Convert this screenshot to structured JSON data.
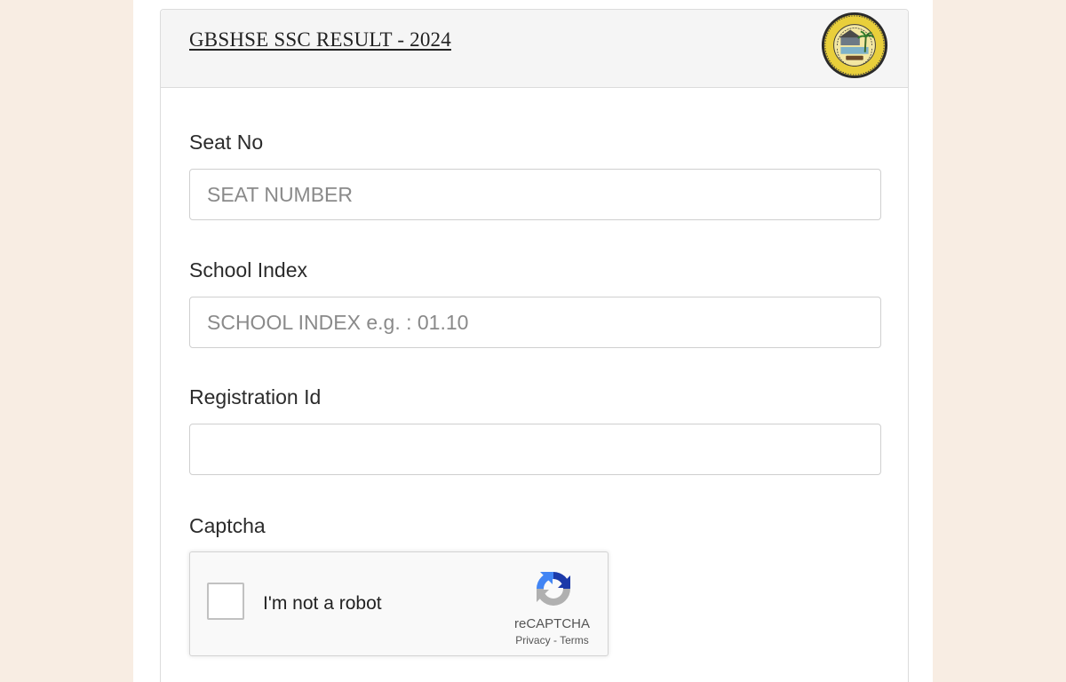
{
  "header": {
    "title": "GBSHSE SSC RESULT - 2024",
    "seal_icon": "board-seal-icon"
  },
  "form": {
    "seat_no": {
      "label": "Seat No",
      "placeholder": "SEAT NUMBER",
      "value": ""
    },
    "school_index": {
      "label": "School Index",
      "placeholder": "SCHOOL INDEX e.g. : 01.10",
      "value": ""
    },
    "registration_id": {
      "label": "Registration Id",
      "placeholder": "",
      "value": ""
    },
    "captcha": {
      "label": "Captcha",
      "checkbox_label": "I'm not a robot",
      "brand": "reCAPTCHA",
      "privacy_link": "Privacy",
      "separator": "-",
      "terms_link": "Terms",
      "checked": false
    }
  },
  "colors": {
    "page_background": "#f8ede3",
    "card_header_background": "#f5f5f5",
    "recaptcha_blue": "#1c3aa9",
    "recaptcha_light_blue": "#4285f4",
    "recaptcha_gray": "#b0b0b0"
  }
}
